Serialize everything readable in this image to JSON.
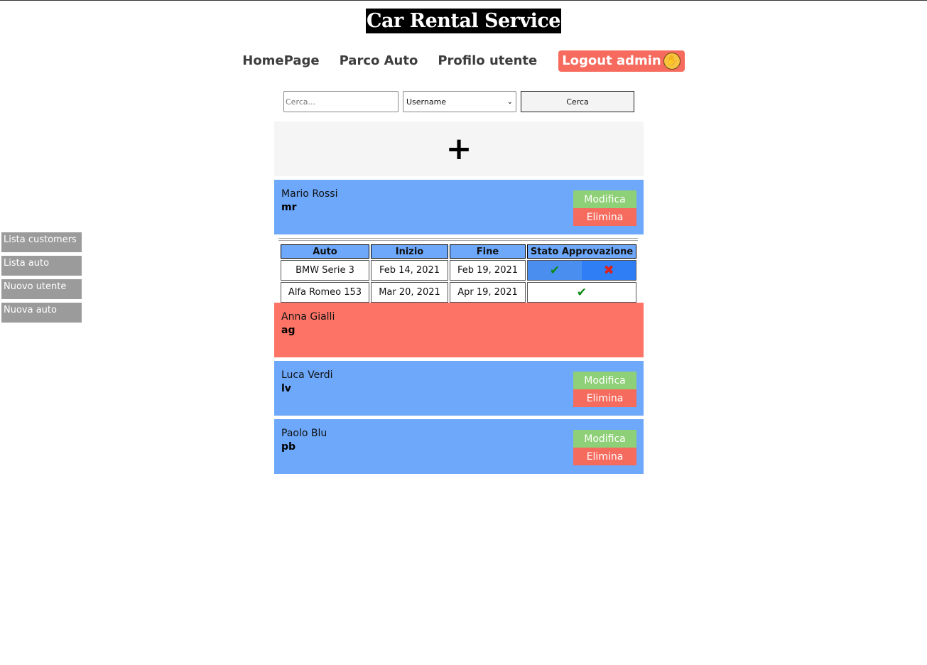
{
  "app": {
    "title": "Car Rental Service"
  },
  "nav": {
    "home": "HomePage",
    "fleet": "Parco Auto",
    "profile": "Profilo utente",
    "logout": "Logout admin",
    "logout_icon": "waving-hand-icon"
  },
  "search": {
    "placeholder": "Cerca...",
    "filter_selected": "Username",
    "button_label": "Cerca"
  },
  "add": {
    "icon": "plus-icon",
    "symbol": "+"
  },
  "sidebar": {
    "items": [
      {
        "label": "Lista customers"
      },
      {
        "label": "Lista auto"
      },
      {
        "label": "Nuovo utente"
      },
      {
        "label": "Nuova auto"
      }
    ]
  },
  "users": [
    {
      "name": "Mario Rossi",
      "username": "mr",
      "edit_label": "Modifica",
      "delete_label": "Elimina",
      "status": "blue"
    },
    {
      "name": "Anna Gialli",
      "username": "ag",
      "status": "red"
    },
    {
      "name": "Luca Verdi",
      "username": "lv",
      "edit_label": "Modifica",
      "delete_label": "Elimina",
      "status": "blue"
    },
    {
      "name": "Paolo Blu",
      "username": "pb",
      "edit_label": "Modifica",
      "delete_label": "Elimina",
      "status": "blue"
    }
  ],
  "rentals": {
    "headers": [
      "Auto",
      "Inizio",
      "Fine",
      "Stato Approvazione"
    ],
    "rows": [
      {
        "car": "BMW Serie 3",
        "start": "Feb 14, 2021",
        "end": "Feb 19, 2021",
        "state": "pending",
        "approve_icon": "check-icon",
        "reject_icon": "x-icon"
      },
      {
        "car": "Alfa Romeo 153",
        "start": "Mar 20, 2021",
        "end": "Apr 19, 2021",
        "state": "approved",
        "approved_icon": "check-icon"
      }
    ]
  },
  "colors": {
    "card_blue": "#6da8fb",
    "card_red": "#fd7466",
    "edit_green": "#8ed077",
    "delete_red": "#f56b5e",
    "logout_red": "#f76a5e",
    "sidebar_gray": "#9b9b9b"
  }
}
